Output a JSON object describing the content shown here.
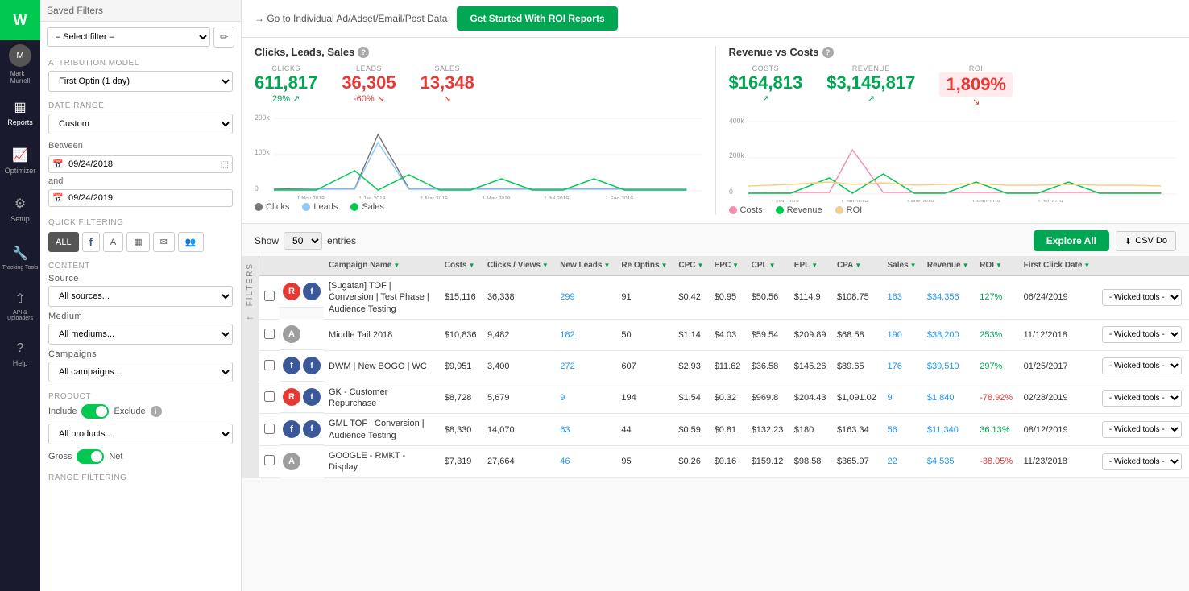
{
  "nav": {
    "logo": "W",
    "items": [
      {
        "label": "Mark Murrell",
        "icon": "👤",
        "id": "profile"
      },
      {
        "label": "Reports",
        "icon": "📊",
        "id": "reports",
        "active": true
      },
      {
        "label": "Optimizer",
        "icon": "📈",
        "id": "optimizer"
      },
      {
        "label": "Setup",
        "icon": "⚙️",
        "id": "setup"
      },
      {
        "label": "Tracking Tools",
        "icon": "🔧",
        "id": "tracking"
      },
      {
        "label": "API & Uploaders",
        "icon": "↑",
        "id": "api"
      },
      {
        "label": "Help",
        "icon": "?",
        "id": "help"
      }
    ]
  },
  "sidebar": {
    "saved_filters": {
      "title": "Saved Filters",
      "placeholder": "– Select filter –"
    },
    "attribution_model": {
      "label": "Attribution Model",
      "value": "First Optin (1 day)"
    },
    "date_range": {
      "label": "Date Range",
      "value": "Custom",
      "between_label": "Between",
      "and_label": "and",
      "start_date": "09/24/2018",
      "end_date": "09/24/2019"
    },
    "quick_filtering": {
      "label": "QUICK FILTERING",
      "buttons": [
        "ALL",
        "f",
        "A",
        "✉",
        "✉",
        "👥"
      ]
    },
    "content": {
      "label": "CONTENT",
      "source_label": "Source",
      "source_value": "All sources...",
      "medium_label": "Medium",
      "medium_value": "All mediums...",
      "campaigns_label": "Campaigns",
      "campaigns_value": "All campaigns..."
    },
    "product": {
      "label": "PRODUCT",
      "include_label": "Include",
      "exclude_label": "Exclude",
      "value": "All products...",
      "gross_label": "Gross",
      "net_label": "Net"
    },
    "range_filtering": {
      "label": "RANGE FILTERING"
    }
  },
  "top_bar": {
    "link_text": "→ Go to Individual Ad/Adset/Email/Post Data",
    "button_label": "Get Started With ROI Reports"
  },
  "clicks_leads_sales": {
    "title": "Clicks, Leads, Sales",
    "metrics": [
      {
        "label": "CLICKS",
        "value": "611,817",
        "change": "29%",
        "change_dir": "up",
        "color": "green"
      },
      {
        "label": "LEADS",
        "value": "36,305",
        "change": "-60%",
        "change_dir": "down",
        "color": "red"
      },
      {
        "label": "SALES",
        "value": "13,348",
        "change": "",
        "change_dir": "down",
        "color": "red"
      }
    ],
    "legend": [
      {
        "label": "Clicks",
        "color": "#757575"
      },
      {
        "label": "Leads",
        "color": "#90caf9"
      },
      {
        "label": "Sales",
        "color": "#00c851"
      }
    ],
    "x_labels": [
      "1 Nov 2018",
      "1 Jan 2019",
      "1 Mar 2019",
      "1 May 2019",
      "1 Jul 2019",
      "1 Sep 2019"
    ],
    "y_labels": [
      "200k",
      "100k",
      "0"
    ]
  },
  "revenue_vs_costs": {
    "title": "Revenue vs Costs",
    "metrics": [
      {
        "label": "COSTS",
        "value": "$164,813",
        "change": "",
        "change_dir": "up",
        "color": "green"
      },
      {
        "label": "REVENUE",
        "value": "$3,145,817",
        "change": "",
        "change_dir": "up",
        "color": "green"
      },
      {
        "label": "ROI",
        "value": "1,809%",
        "change": "",
        "change_dir": "down",
        "color": "red"
      }
    ],
    "legend": [
      {
        "label": "Costs",
        "color": "#f48fb1"
      },
      {
        "label": "Revenue",
        "color": "#00c851"
      },
      {
        "label": "ROI",
        "color": "#ffcc80"
      }
    ],
    "x_labels": [
      "1 Nov 2018",
      "1 Jan 2019",
      "1 Mar 2019",
      "1 May 2019",
      "1 Jul 2019"
    ],
    "y_labels": [
      "400k",
      "200k",
      "0"
    ]
  },
  "table": {
    "show_label": "Show",
    "entries_label": "entries",
    "entries_value": "50",
    "csv_button": "CSV Do",
    "explore_button": "Explore All",
    "columns": [
      {
        "label": "Campaign Name",
        "sortable": true
      },
      {
        "label": "Costs",
        "sortable": true
      },
      {
        "label": "Clicks / Views",
        "sortable": true
      },
      {
        "label": "New Leads",
        "sortable": true
      },
      {
        "label": "Re Optins",
        "sortable": true
      },
      {
        "label": "CPC",
        "sortable": true
      },
      {
        "label": "EPC",
        "sortable": true
      },
      {
        "label": "CPL",
        "sortable": true
      },
      {
        "label": "EPL",
        "sortable": true
      },
      {
        "label": "CPA",
        "sortable": true
      },
      {
        "label": "Sales",
        "sortable": true
      },
      {
        "label": "Revenue",
        "sortable": true
      },
      {
        "label": "ROI",
        "sortable": true
      },
      {
        "label": "First Click Date",
        "sortable": true
      },
      {
        "label": "",
        "sortable": false
      }
    ],
    "rows": [
      {
        "icon_type": "red",
        "icon_text": "R",
        "platform": "f",
        "campaign": "[Sugatan] TOF | Conversion | Test Phase | Audience Testing",
        "cost": "$15,116",
        "clicks": "36,338",
        "new_leads": "299",
        "re_optins": "91",
        "cpc": "$0.42",
        "epc": "$0.95",
        "cpl": "$50.56",
        "epl": "$114.9",
        "cpa": "$108.75",
        "sales": "163",
        "revenue": "$34,356",
        "roi": "127%",
        "roi_color": "green",
        "first_click": "06/24/2019",
        "wicked": "- Wicked tools -"
      },
      {
        "icon_type": "gray",
        "icon_text": "A",
        "platform": "",
        "campaign": "Middle Tail 2018",
        "cost": "$10,836",
        "clicks": "9,482",
        "new_leads": "182",
        "re_optins": "50",
        "cpc": "$1.14",
        "epc": "$4.03",
        "cpl": "$59.54",
        "epl": "$209.89",
        "cpa": "$68.58",
        "sales": "190",
        "revenue": "$38,200",
        "roi": "253%",
        "roi_color": "green",
        "first_click": "11/12/2018",
        "wicked": "- Wicked tools -"
      },
      {
        "icon_type": "blue",
        "icon_text": "f",
        "platform": "f",
        "campaign": "DWM | New BOGO | WC",
        "cost": "$9,951",
        "clicks": "3,400",
        "new_leads": "272",
        "re_optins": "607",
        "cpc": "$2.93",
        "epc": "$11.62",
        "cpl": "$36.58",
        "epl": "$145.26",
        "cpa": "$89.65",
        "sales": "176",
        "revenue": "$39,510",
        "roi": "297%",
        "roi_color": "green",
        "first_click": "01/25/2017",
        "wicked": "- Wicked tools -"
      },
      {
        "icon_type": "red",
        "icon_text": "R",
        "platform": "f",
        "campaign": "GK - Customer Repurchase",
        "cost": "$8,728",
        "clicks": "5,679",
        "new_leads": "9",
        "re_optins": "194",
        "cpc": "$1.54",
        "epc": "$0.32",
        "cpl": "$969.8",
        "epl": "$204.43",
        "cpa": "$1,091.02",
        "sales": "9",
        "revenue": "$1,840",
        "roi": "-78.92%",
        "roi_color": "red",
        "first_click": "02/28/2019",
        "wicked": "- Wicked tools -"
      },
      {
        "icon_type": "blue",
        "icon_text": "f",
        "platform": "f",
        "campaign": "GML TOF | Conversion | Audience Testing",
        "cost": "$8,330",
        "clicks": "14,070",
        "new_leads": "63",
        "re_optins": "44",
        "cpc": "$0.59",
        "epc": "$0.81",
        "cpl": "$132.23",
        "epl": "$180",
        "cpa": "$163.34",
        "sales": "56",
        "revenue": "$11,340",
        "roi": "36.13%",
        "roi_color": "green",
        "first_click": "08/12/2019",
        "wicked": "- Wicked tools -"
      },
      {
        "icon_type": "gray",
        "icon_text": "A",
        "platform": "",
        "campaign": "GOOGLE - RMKT - Display",
        "cost": "$7,319",
        "clicks": "27,664",
        "new_leads": "46",
        "re_optins": "95",
        "cpc": "$0.26",
        "epc": "$0.16",
        "cpl": "$159.12",
        "epl": "$98.58",
        "cpa": "$365.97",
        "sales": "22",
        "revenue": "$4,535",
        "roi": "-38.05%",
        "roi_color": "red",
        "first_click": "11/23/2018",
        "wicked": "- Wicked tools -"
      }
    ]
  }
}
